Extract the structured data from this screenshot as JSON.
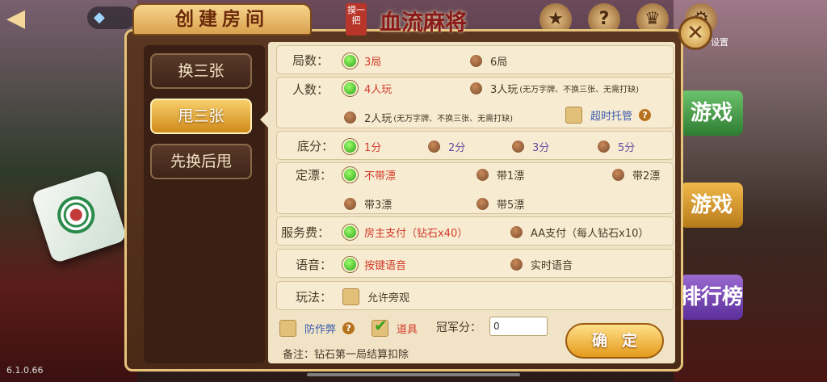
{
  "version": "6.1.0.66",
  "top_icons": [
    "star-icon",
    "help-icon",
    "trophy-icon",
    "settings-icon"
  ],
  "top_icon_glyphs": [
    "★",
    "?",
    "♛",
    "⚙"
  ],
  "settings_label": "设置",
  "side_buttons": [
    "游戏",
    "游戏",
    "排行榜"
  ],
  "dialog": {
    "title": "创建房间",
    "game_name": "血流麻将",
    "seal_text": "摸一把"
  },
  "modes": [
    {
      "label": "换三张",
      "selected": false
    },
    {
      "label": "甩三张",
      "selected": true
    },
    {
      "label": "先换后甩",
      "selected": false
    }
  ],
  "settings": {
    "rounds": {
      "label": "局数：",
      "options": [
        "3局",
        "6局"
      ],
      "selected": 0
    },
    "players": {
      "label": "人数：",
      "options": [
        {
          "text": "4人玩",
          "note": ""
        },
        {
          "text": "3人玩",
          "note": "(无万字牌、不换三张、无需打缺)"
        },
        {
          "text": "2人玩",
          "note": "(无万字牌、不换三张、无需打缺)"
        }
      ],
      "selected": 0,
      "timeout_label": "超时托管",
      "timeout_checked": false
    },
    "base": {
      "label": "底分：",
      "options": [
        "1分",
        "2分",
        "3分",
        "5分"
      ],
      "selected": 0
    },
    "piao": {
      "label": "定漂：",
      "options": [
        "不带漂",
        "带1漂",
        "带2漂",
        "带3漂",
        "带5漂"
      ],
      "selected": 0
    },
    "fee": {
      "label": "服务费：",
      "options": [
        "房主支付（钻石x40）",
        "AA支付（每人钻石x10）"
      ],
      "selected": 0
    },
    "voice": {
      "label": "语音：",
      "options": [
        "按键语音",
        "实时语音"
      ],
      "selected": 0
    },
    "play": {
      "label": "玩法：",
      "option": "允许旁观",
      "checked": false
    }
  },
  "anti_cheat": {
    "label": "防作弊",
    "checked": false
  },
  "props": {
    "label": "道具",
    "checked": true
  },
  "champion": {
    "label": "冠军分：",
    "value": "0"
  },
  "confirm_label": "确定",
  "note": "备注：钻石第一局结算扣除"
}
